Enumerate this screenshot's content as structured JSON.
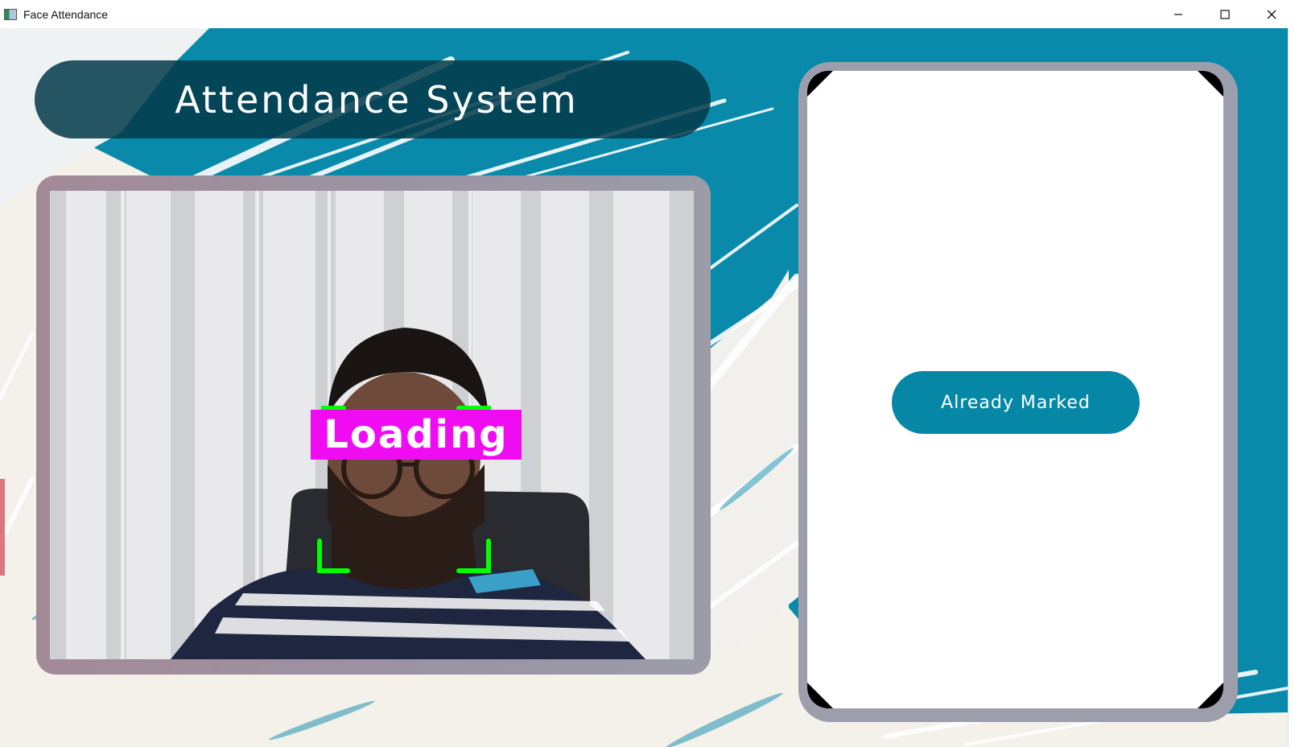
{
  "window": {
    "title": "Face Attendance",
    "icon": "app-window-icon",
    "controls": [
      "minimize-icon",
      "maximize-icon",
      "close-icon"
    ]
  },
  "header": {
    "title": "Attendance System"
  },
  "camera": {
    "status_label": "Loading",
    "status_color": "#f00cf2",
    "face_box_color": "#00ff00"
  },
  "info_panel": {
    "status_button": "Already Marked",
    "button_color": "#0787a6"
  },
  "colors": {
    "background_teal": "#0a8aaa",
    "header_dark": "#033a4a",
    "frame_gray": "#9c9fab"
  }
}
